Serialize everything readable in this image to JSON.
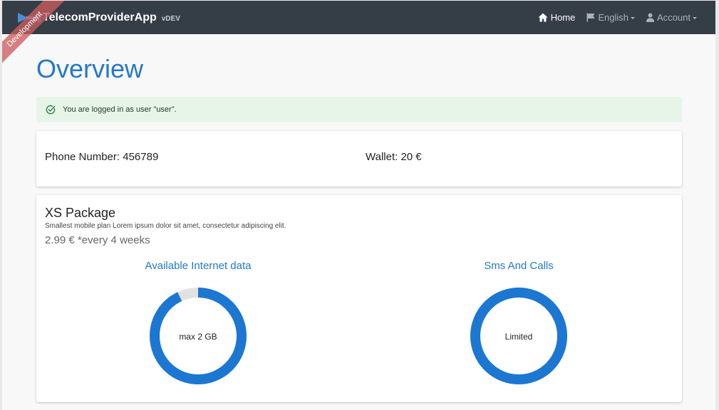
{
  "navbar": {
    "brand_name": "TelecomProviderApp",
    "version": "vDEV",
    "items": [
      {
        "label": "Home",
        "icon": "home-icon",
        "active": true
      },
      {
        "label": "English",
        "icon": "flag-icon",
        "dropdown": true
      },
      {
        "label": "Account",
        "icon": "user-icon",
        "dropdown": true
      }
    ]
  },
  "ribbon": {
    "label": "Development"
  },
  "page": {
    "title": "Overview"
  },
  "alert": {
    "text": "You are logged in as user \"user\".",
    "icon": "check-circle-icon"
  },
  "account": {
    "phone": "Phone Number: 456789",
    "wallet": "Wallet: 20 €"
  },
  "package": {
    "name": "XS Package",
    "description": "Smallest mobile plan Lorem ipsum dolor sit amet, consectetur adipiscing elit.",
    "price": "2.99 € *every 4 weeks"
  },
  "charts": [
    {
      "title": "Available Internet data",
      "center_label": "max 2 GB",
      "fill_fraction": 0.93
    },
    {
      "title": "Sms And Calls",
      "center_label": "Limited",
      "fill_fraction": 1.0
    }
  ],
  "colors": {
    "navbar_bg": "#353d47",
    "accent": "#2478cc",
    "donut_fill": "#1c77d2",
    "donut_track": "#e2e2e2",
    "alert_bg": "#e7f5e9"
  }
}
